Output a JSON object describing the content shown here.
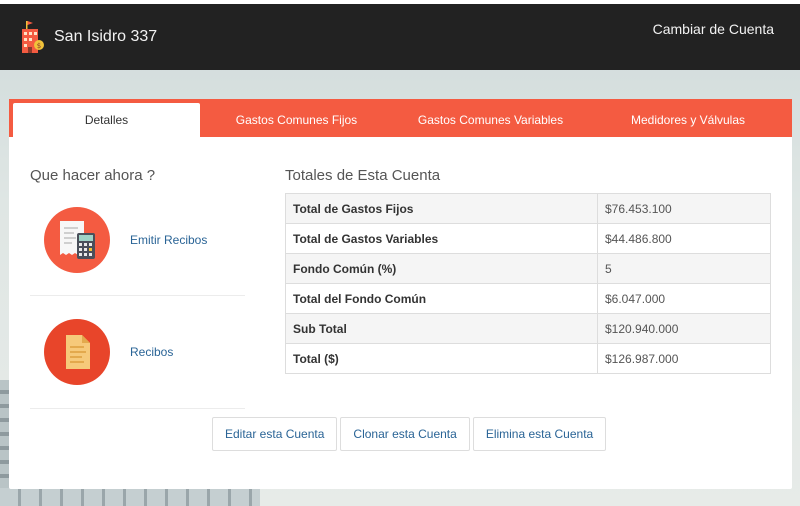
{
  "navbar": {
    "brand_name": "San Isidro 337",
    "brand_icon": "building-icon",
    "right_link": "Cambiar de Cuenta"
  },
  "tabs": [
    {
      "label": "Detalles",
      "active": true
    },
    {
      "label": "Gastos Comunes Fijos",
      "active": false
    },
    {
      "label": "Gastos Comunes Variables",
      "active": false
    },
    {
      "label": "Medidores y Válvulas",
      "active": false
    }
  ],
  "left": {
    "title": "Que hacer ahora ?",
    "actions": [
      {
        "label": "Emitir Recibos",
        "icon": "receipt-calculator-icon"
      },
      {
        "label": "Recibos",
        "icon": "document-icon"
      }
    ]
  },
  "totals": {
    "title": "Totales de Esta Cuenta",
    "rows": [
      {
        "label": "Total de Gastos Fijos",
        "value": "$76.453.100"
      },
      {
        "label": "Total de Gastos Variables",
        "value": "$44.486.800"
      },
      {
        "label": "Fondo Común (%)",
        "value": "5"
      },
      {
        "label": "Total del Fondo Común",
        "value": "$6.047.000"
      },
      {
        "label": "Sub Total",
        "value": "$120.940.000"
      },
      {
        "label": "Total ($)",
        "value": "$126.987.000"
      }
    ]
  },
  "buttons": {
    "edit": "Editar esta Cuenta",
    "clone": "Clonar esta Cuenta",
    "delete": "Elimina esta Cuenta"
  },
  "colors": {
    "navbar": "#222222",
    "accent": "#f45b41",
    "link": "#2a6496"
  }
}
